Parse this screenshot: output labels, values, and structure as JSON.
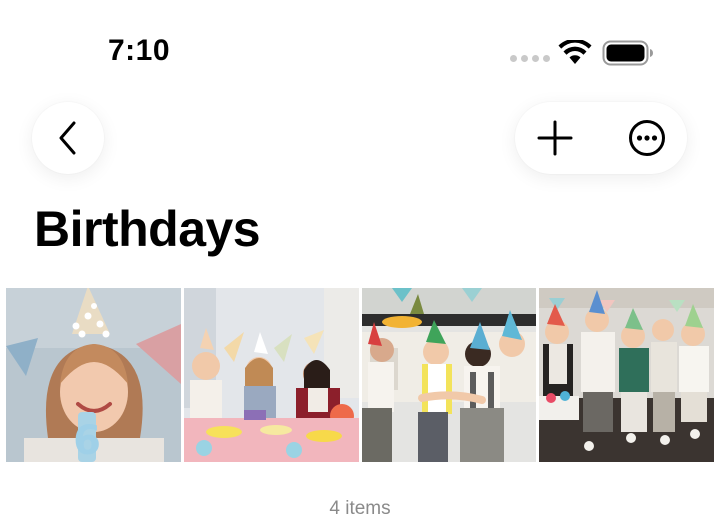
{
  "status_bar": {
    "time": "7:10"
  },
  "album": {
    "title": "Birthdays",
    "photos": [
      {
        "icon": "photo-girl-birthday-candle"
      },
      {
        "icon": "photo-kids-party-table"
      },
      {
        "icon": "photo-kids-party-hats"
      },
      {
        "icon": "photo-kids-group-party"
      }
    ],
    "item_count_label": "4 items"
  },
  "colors": {
    "background": "#ffffff",
    "muted_text": "#8a8a8a"
  }
}
